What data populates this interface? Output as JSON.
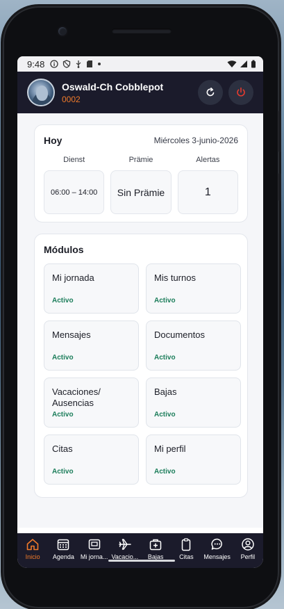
{
  "status_bar": {
    "time": "9:48"
  },
  "header": {
    "user_name": "Oswald-Ch Cobblepot",
    "user_id": "0002"
  },
  "today": {
    "title": "Hoy",
    "date": "Miércoles 3-junio-2026",
    "stats": [
      {
        "label": "Dienst",
        "value": "06:00 – 14:00"
      },
      {
        "label": "Prämie",
        "value": "Sin Prämie"
      },
      {
        "label": "Alertas",
        "value": "1"
      }
    ]
  },
  "modules": {
    "title": "Módulos",
    "items": [
      {
        "name": "Mi jornada",
        "status": "Activo"
      },
      {
        "name": "Mis turnos",
        "status": "Activo"
      },
      {
        "name": "Mensajes",
        "status": "Activo"
      },
      {
        "name": "Documentos",
        "status": "Activo"
      },
      {
        "name": "Vacaciones/ Ausencias",
        "status": "Activo"
      },
      {
        "name": "Bajas",
        "status": "Activo"
      },
      {
        "name": "Citas",
        "status": "Activo"
      },
      {
        "name": "Mi perfil",
        "status": "Activo"
      }
    ]
  },
  "nav": [
    {
      "label": "Inicio",
      "icon": "home-icon"
    },
    {
      "label": "Agenda",
      "icon": "calendar-icon"
    },
    {
      "label": "Mi jorna...",
      "icon": "clock-card-icon"
    },
    {
      "label": "Vacacio...",
      "icon": "plane-icon"
    },
    {
      "label": "Bajas",
      "icon": "medical-bag-icon"
    },
    {
      "label": "Citas",
      "icon": "clipboard-icon"
    },
    {
      "label": "Mensajes",
      "icon": "chat-icon"
    },
    {
      "label": "Perfil",
      "icon": "user-icon"
    }
  ],
  "colors": {
    "header_bg": "#1b1b2b",
    "accent": "#f07a2a",
    "status_active": "#1b7d5a"
  }
}
